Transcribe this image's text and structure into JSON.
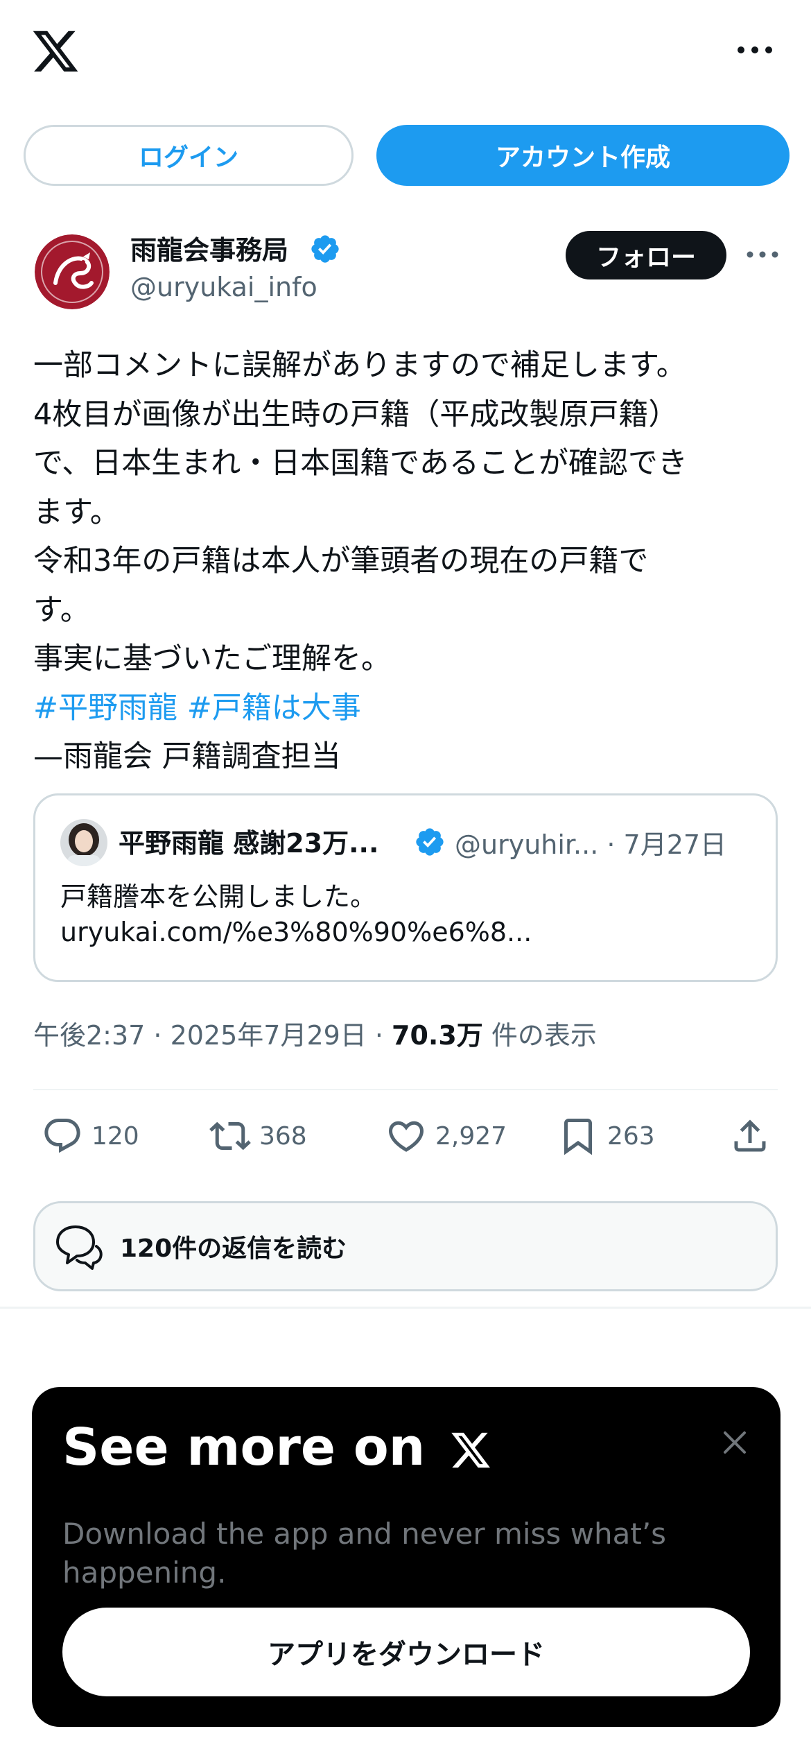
{
  "header": {
    "logo": "x-logo-icon",
    "more": "more-horizontal-icon"
  },
  "auth": {
    "login_label": "ログイン",
    "signup_label": "アカウント作成"
  },
  "author": {
    "name": "雨龍会事務局",
    "handle": "@uryukai_info",
    "follow_label": "フォロー",
    "verified_color": "#1d9bf0"
  },
  "tweet": {
    "lines": [
      "一部コメントに誤解がありますので補足します。",
      "4枚目が画像が出生時の戸籍（平成改製原戸籍）",
      "で、日本生まれ・日本国籍であることが確認でき",
      "ます。",
      "令和3年の戸籍は本人が筆頭者の現在の戸籍で",
      "す。",
      "事実に基づいたご理解を。"
    ],
    "hashtag_1": "#平野雨龍",
    "hashtag_2": "#戸籍は大事",
    "signature": "—雨龍会 戸籍調査担当"
  },
  "quote": {
    "name": "平野雨龍 感謝23万...",
    "handle": "@uryuhir... · 7月27日",
    "text": "戸籍謄本を公開しました。",
    "url": "uryukai.com/%e3%80%90%e6%8..."
  },
  "meta": {
    "time": "午後2:37 · 2025年7月29日 · ",
    "views_count": "70.3万",
    "views_label": " 件の表示"
  },
  "actions": {
    "replies": "120",
    "retweets": "368",
    "likes": "2,927",
    "bookmarks": "263"
  },
  "read_replies_label": "120件の返信を読む",
  "banner": {
    "title": "See more on",
    "subtitle": "Download the app and never miss what’s happening.",
    "download_label": "アプリをダウンロード"
  },
  "colors": {
    "accent": "#1d9bf0",
    "text": "#0f1419",
    "muted": "#536471",
    "border": "#cfd9de"
  }
}
